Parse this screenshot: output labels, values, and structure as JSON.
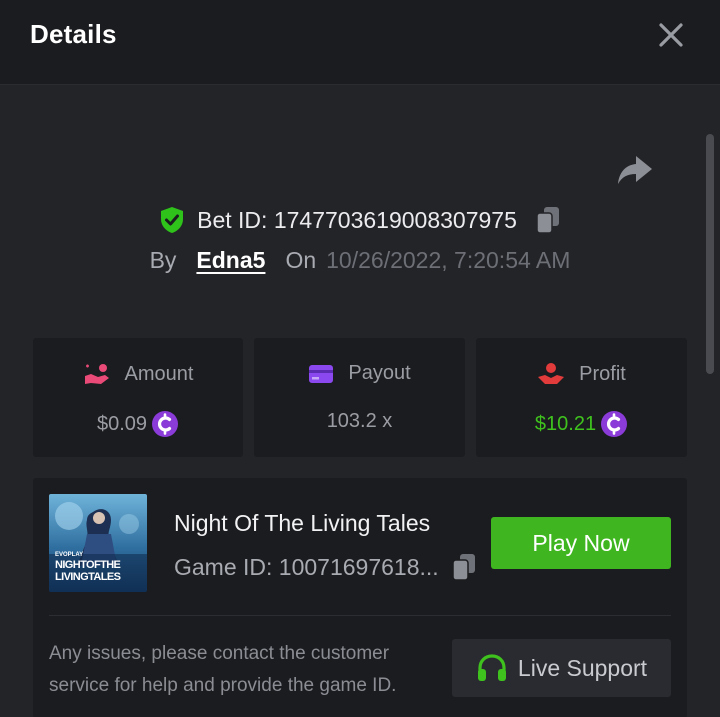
{
  "header": {
    "title": "Details"
  },
  "bet": {
    "id_label": "Bet ID: 1747703619008307975",
    "by_label": "By",
    "username": "Edna5",
    "on_label": "On",
    "datetime": "10/26/2022, 7:20:54 AM"
  },
  "stats": {
    "amount": {
      "label": "Amount",
      "value": "$0.09",
      "icon": "hand-coin-icon",
      "color": "#e94a77"
    },
    "payout": {
      "label": "Payout",
      "value": "103.2 x",
      "icon": "card-icon",
      "color": "#8a48ee"
    },
    "profit": {
      "label": "Profit",
      "value": "$10.21",
      "icon": "hand-heart-icon",
      "color": "#e23b3b",
      "value_color": "#3fc21e"
    }
  },
  "game": {
    "name": "Night Of The Living Tales",
    "game_id": "Game ID: 10071697618...",
    "thumb_brand": "EVOPLAY",
    "thumb_line1": "NIGHTOFTHE",
    "thumb_line2": "LIVINGTALES",
    "play_label": "Play Now"
  },
  "support": {
    "text": "Any issues, please contact the customer service for help and provide the game ID.",
    "button_label": "Live Support"
  },
  "colors": {
    "accent_green": "#3fb61f",
    "coin_purple": "#8a3bd8",
    "background": "#232428",
    "card": "#1b1c1f"
  }
}
